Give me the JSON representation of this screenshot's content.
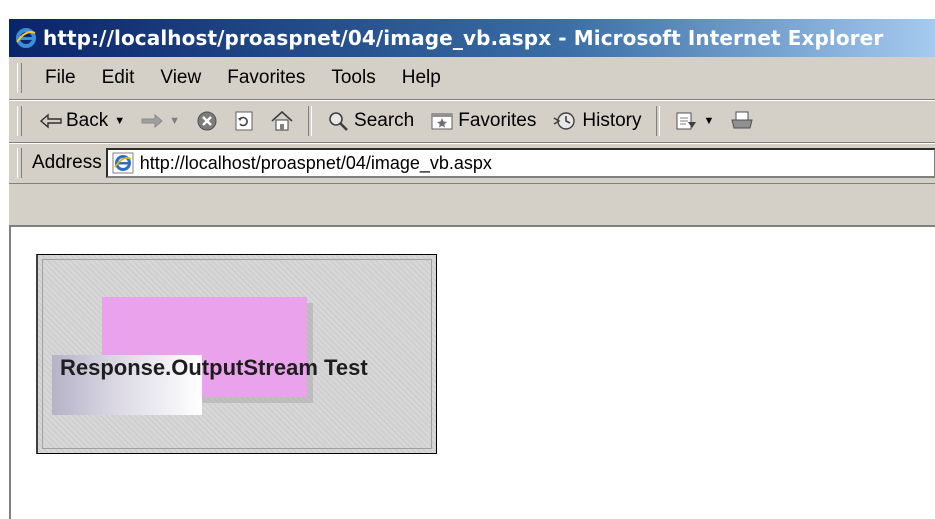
{
  "window": {
    "title": "http://localhost/proaspnet/04/image_vb.aspx - Microsoft Internet Explorer"
  },
  "menubar": {
    "items": [
      "File",
      "Edit",
      "View",
      "Favorites",
      "Tools",
      "Help"
    ]
  },
  "toolbar": {
    "back_label": "Back",
    "search_label": "Search",
    "favorites_label": "Favorites",
    "history_label": "History"
  },
  "address": {
    "label": "Address",
    "url": "http://localhost/proaspnet/04/image_vb.aspx"
  },
  "image": {
    "text": "Response.OutputStream Test"
  },
  "icons": {
    "title": "ie-logo-icon",
    "back": "back-arrow-icon",
    "forward": "forward-arrow-icon",
    "stop": "stop-icon",
    "refresh": "refresh-icon",
    "home": "home-icon",
    "search": "search-icon",
    "favorites": "favorites-icon",
    "history": "history-icon",
    "mail": "mail-icon",
    "print": "print-icon"
  },
  "colors": {
    "title_start": "#0a246a",
    "title_end": "#a6caf0",
    "chrome": "#d4d0c8",
    "pink_box": "#eaa2ec"
  }
}
